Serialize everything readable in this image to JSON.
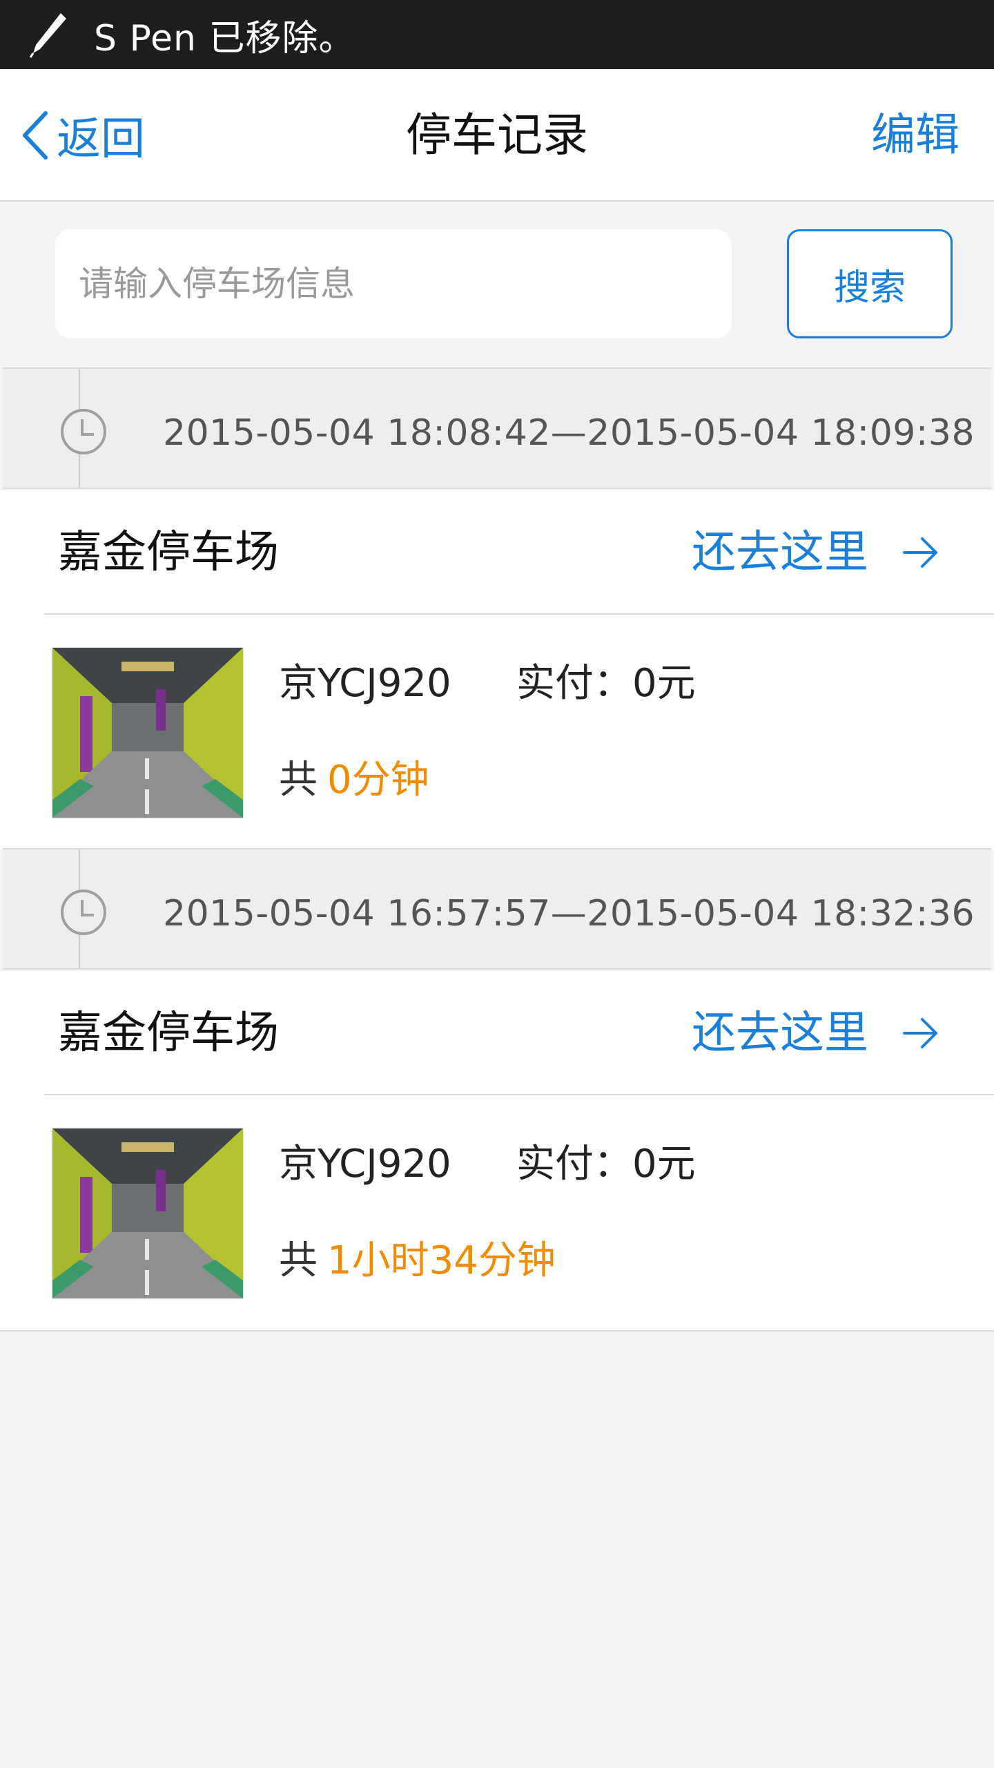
{
  "status_bar": {
    "message": "S Pen 已移除。",
    "icon": "pen-icon"
  },
  "nav": {
    "back_label": "返回",
    "title": "停车记录",
    "edit_label": "编辑"
  },
  "search": {
    "placeholder": "请输入停车场信息",
    "button_label": "搜索"
  },
  "records": [
    {
      "time_range": "2015-05-04 18:08:42—2015-05-04 18:09:38",
      "lot_name": "嘉金停车场",
      "go_label": "还去这里",
      "plate": "京YCJ920",
      "paid": "实付：0元",
      "duration_prefix": "共",
      "duration": "0分钟"
    },
    {
      "time_range": "2015-05-04 16:57:57—2015-05-04 18:32:36",
      "lot_name": "嘉金停车场",
      "go_label": "还去这里",
      "plate": "京YCJ920",
      "paid": "实付：0元",
      "duration_prefix": "共",
      "duration": "1小时34分钟"
    }
  ],
  "colors": {
    "accent": "#1a7fd8",
    "duration": "#f08c00",
    "background": "#f3f4f6"
  }
}
